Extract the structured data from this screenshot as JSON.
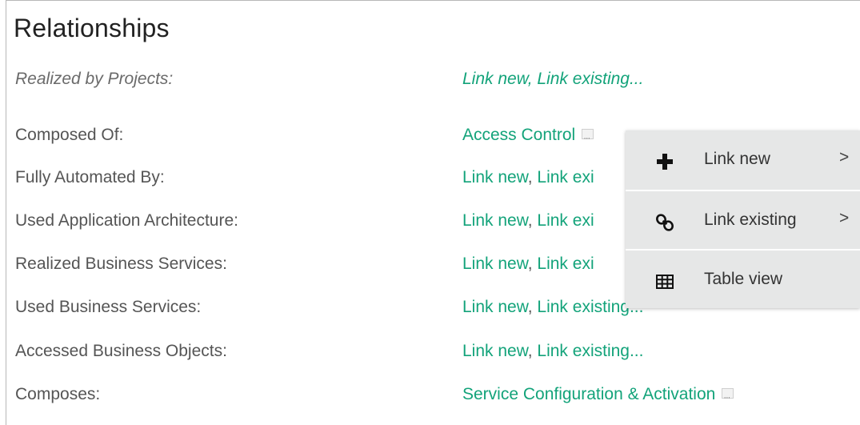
{
  "section": {
    "title": "Relationships"
  },
  "rows": [
    {
      "label": "Realized by Projects:",
      "values": [
        "Link new",
        "Link existing..."
      ],
      "italic": true
    },
    {
      "label": "Composed Of:",
      "values": [
        "Access Control"
      ]
    },
    {
      "label": "Fully Automated By:",
      "values": [
        "Link new",
        "Link exi"
      ]
    },
    {
      "label": "Used Application Architecture:",
      "values": [
        "Link new",
        "Link exi"
      ]
    },
    {
      "label": "Realized Business Services:",
      "values": [
        "Link new",
        "Link exi"
      ]
    },
    {
      "label": "Used Business Services:",
      "values": [
        "Link new",
        "Link existing..."
      ]
    },
    {
      "label": "Accessed Business Objects:",
      "values": [
        "Link new",
        "Link existing..."
      ]
    },
    {
      "label": "Composes:",
      "values": [
        "Service Configuration & Activation"
      ]
    }
  ],
  "separator": ", ",
  "context_menu": {
    "items": [
      {
        "label": "Link new",
        "icon": "plus-icon",
        "has_submenu": true,
        "submenu_indicator": ">"
      },
      {
        "label": "Link existing",
        "icon": "link-icon",
        "has_submenu": true,
        "submenu_indicator": ">"
      },
      {
        "label": "Table view",
        "icon": "table-icon",
        "has_submenu": false
      }
    ]
  },
  "colors": {
    "link": "#13a37a",
    "label": "#555555",
    "menu_bg": "#e6e7e7"
  }
}
